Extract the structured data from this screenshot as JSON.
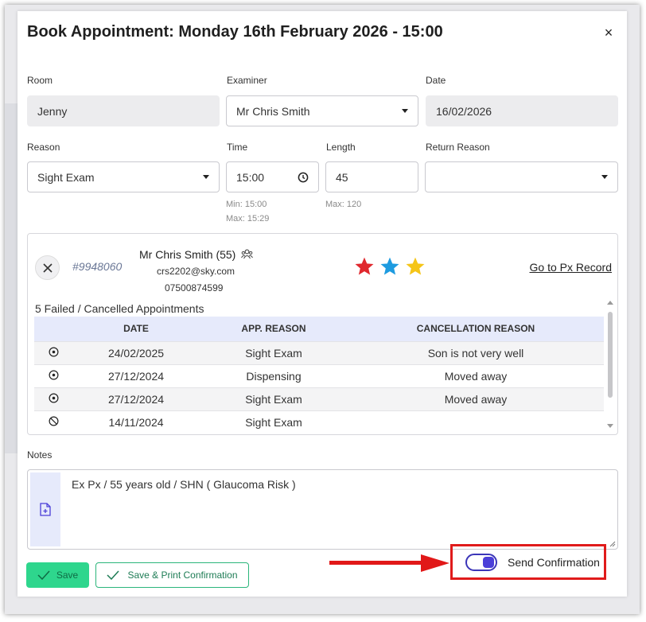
{
  "dialog": {
    "title": "Book Appointment: Monday 16th February 2026 - 15:00",
    "close_label": "×"
  },
  "fields": {
    "room": {
      "label": "Room",
      "value": "Jenny"
    },
    "examiner": {
      "label": "Examiner",
      "value": "Mr Chris Smith"
    },
    "date": {
      "label": "Date",
      "value": "16/02/2026"
    },
    "reason": {
      "label": "Reason",
      "value": "Sight Exam"
    },
    "time": {
      "label": "Time",
      "value": "15:00",
      "min": "Min: 15:00",
      "max": "Max: 15:29"
    },
    "length": {
      "label": "Length",
      "value": "45",
      "max": "Max: 120"
    },
    "return_reason": {
      "label": "Return Reason",
      "value": ""
    }
  },
  "patient": {
    "id": "#9948060",
    "name": "Mr Chris Smith (55)",
    "email": "crs2202@sky.com",
    "phone": "07500874599",
    "record_link": "Go to Px Record",
    "star_colors": [
      "#e0282e",
      "#1e9be0",
      "#f5c518"
    ],
    "failed_title": "5 Failed / Cancelled Appointments",
    "columns": [
      "",
      "DATE",
      "APP. REASON",
      "CANCELLATION REASON"
    ],
    "rows": [
      {
        "icon": "dot-circle-icon",
        "date": "24/02/2025",
        "reason": "Sight Exam",
        "cancellation": "Son is not very well"
      },
      {
        "icon": "dot-circle-icon",
        "date": "27/12/2024",
        "reason": "Dispensing",
        "cancellation": "Moved away"
      },
      {
        "icon": "dot-circle-icon",
        "date": "27/12/2024",
        "reason": "Sight Exam",
        "cancellation": "Moved away"
      },
      {
        "icon": "ban-icon",
        "date": "14/11/2024",
        "reason": "Sight Exam",
        "cancellation": ""
      }
    ]
  },
  "notes": {
    "label": "Notes",
    "value": "Ex Px / 55 years old / SHN ( Glaucoma Risk )"
  },
  "actions": {
    "save_label": "Save",
    "save_print_label": "Save & Print Confirmation",
    "send_confirmation_label": "Send Confirmation",
    "send_confirmation_on": true
  },
  "colors": {
    "accent_green": "#2ed68d",
    "toggle_purple": "#4b3fd8",
    "annotation_red": "#e11818",
    "table_header": "#e6eafb"
  }
}
